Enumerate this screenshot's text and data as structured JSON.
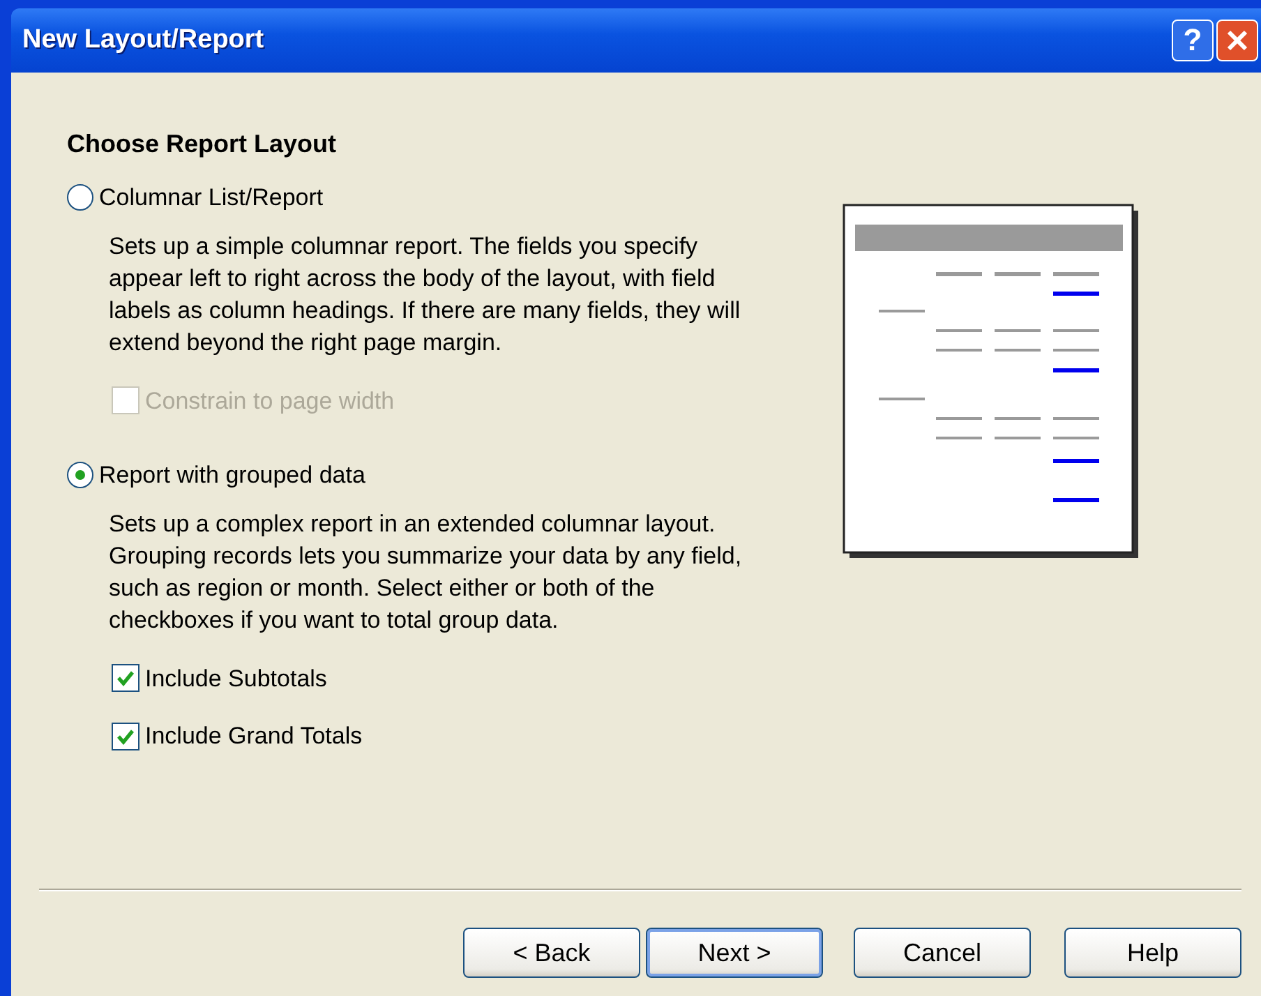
{
  "window": {
    "title": "New Layout/Report",
    "help_button": "?"
  },
  "heading": "Choose Report Layout",
  "options": [
    {
      "label": "Columnar List/Report",
      "selected": false,
      "description": "Sets up a simple columnar report.  The fields you specify appear left to right across the body of the layout, with field labels as column headings.  If there are many fields, they will extend beyond the right page margin.",
      "checkboxes": [
        {
          "label": "Constrain to page width",
          "checked": false,
          "disabled": true
        }
      ]
    },
    {
      "label": "Report with grouped data",
      "selected": true,
      "description": "Sets up a complex report in an extended columnar layout. Grouping records lets you summarize your data by any field, such as region or month. Select either or both of the checkboxes if you want to total group data.",
      "checkboxes": [
        {
          "label": "Include Subtotals",
          "checked": true,
          "disabled": false
        },
        {
          "label": "Include Grand Totals",
          "checked": true,
          "disabled": false
        }
      ]
    }
  ],
  "buttons": [
    {
      "label": "< Back",
      "default": false
    },
    {
      "label": "Next >",
      "default": true
    },
    {
      "label": "Cancel",
      "default": false
    },
    {
      "label": "Help",
      "default": false
    }
  ]
}
